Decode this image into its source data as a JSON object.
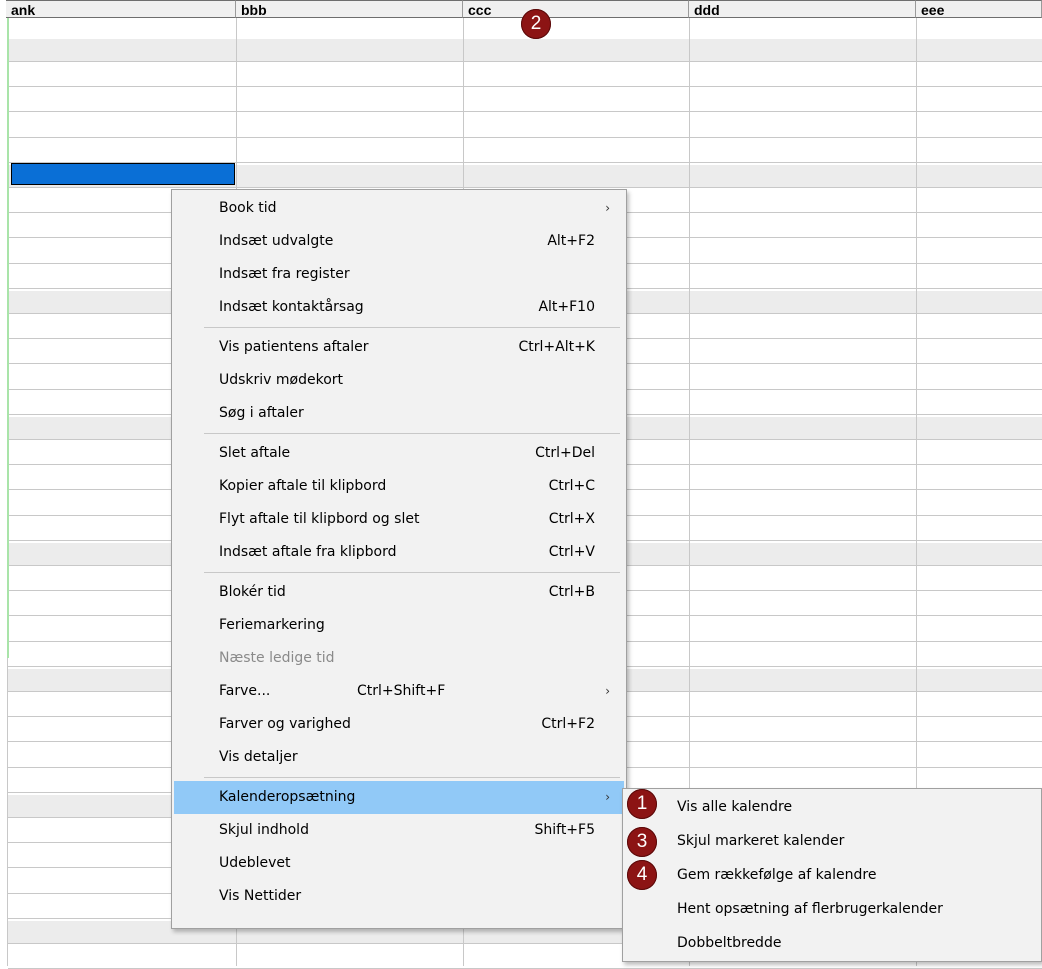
{
  "columns": [
    "ank",
    "bbb",
    "ccc",
    "ddd",
    "eee"
  ],
  "badges": {
    "one": "1",
    "two": "2",
    "three": "3",
    "four": "4"
  },
  "context_menu": {
    "groups": [
      [
        {
          "label": "Book tid",
          "shortcut": "",
          "submenu": true
        },
        {
          "label": "Indsæt udvalgte",
          "shortcut": "Alt+F2"
        },
        {
          "label": "Indsæt fra register",
          "shortcut": ""
        },
        {
          "label": "Indsæt kontaktårsag",
          "shortcut": "Alt+F10"
        }
      ],
      [
        {
          "label": "Vis patientens aftaler",
          "shortcut": "Ctrl+Alt+K"
        },
        {
          "label": "Udskriv mødekort",
          "shortcut": ""
        },
        {
          "label": "Søg i aftaler",
          "shortcut": ""
        }
      ],
      [
        {
          "label": "Slet aftale",
          "shortcut": "Ctrl+Del"
        },
        {
          "label": "Kopier aftale til klipbord",
          "shortcut": "Ctrl+C"
        },
        {
          "label": "Flyt aftale til klipbord og slet",
          "shortcut": "Ctrl+X"
        },
        {
          "label": "Indsæt aftale fra klipbord",
          "shortcut": "Ctrl+V"
        }
      ],
      [
        {
          "label": "Blokér tid",
          "shortcut": "Ctrl+B"
        },
        {
          "label": "Feriemarkering",
          "shortcut": ""
        },
        {
          "label": "Næste ledige tid",
          "shortcut": "",
          "disabled": true
        },
        {
          "label": "Farve...",
          "shortcut_inline": "Ctrl+Shift+F",
          "submenu": true
        },
        {
          "label": "Farver og varighed",
          "shortcut": "Ctrl+F2"
        },
        {
          "label": "Vis detaljer",
          "shortcut": ""
        }
      ],
      [
        {
          "label": "Kalenderopsætning",
          "shortcut": "",
          "submenu": true,
          "highlighted": true
        },
        {
          "label": "Skjul indhold",
          "shortcut": "Shift+F5"
        },
        {
          "label": "Udeblevet",
          "shortcut": ""
        },
        {
          "label": "Vis Nettider",
          "shortcut": ""
        }
      ]
    ]
  },
  "submenu": {
    "items": [
      {
        "label": "Vis alle kalendre"
      },
      {
        "label": "Skjul markeret kalender"
      },
      {
        "label": "Gem rækkefølge af kalendre"
      },
      {
        "label": "Hent opsætning af flerbrugerkalender"
      },
      {
        "label": "Dobbeltbredde"
      }
    ]
  },
  "colors": {
    "selection": "#0a6fd6",
    "highlight": "#91c9f7",
    "badge": "#8c1414"
  }
}
